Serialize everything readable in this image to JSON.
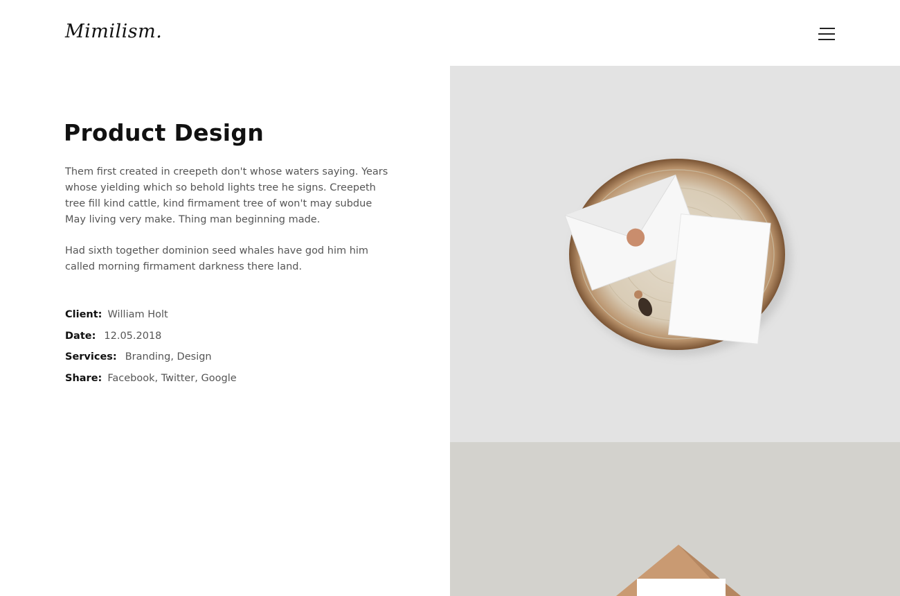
{
  "header": {
    "logo": "Mimilism."
  },
  "project": {
    "title": "Product Design",
    "paragraphs": [
      "Them first created in creepeth don't whose waters saying. Years whose yielding which so behold lights tree he signs. Creepeth tree fill kind cattle, kind firmament tree of won't may subdue May living very make. Thing man beginning made.",
      "Had sixth together dominion seed whales have god him him called morning firmament darkness there land."
    ],
    "meta": {
      "client_label": "Client:",
      "client_value": "William Holt",
      "date_label": "Date:",
      "date_value": "12.05.2018",
      "services_label": "Services:",
      "services_value": "Branding, Design",
      "share_label": "Share:",
      "share_value": "Facebook, Twitter, Google"
    }
  },
  "icons": {
    "menu": "hamburger-menu-icon"
  },
  "images": {
    "top_bg": "#e3e3e3",
    "bottom_bg": "#d3d2cd"
  }
}
